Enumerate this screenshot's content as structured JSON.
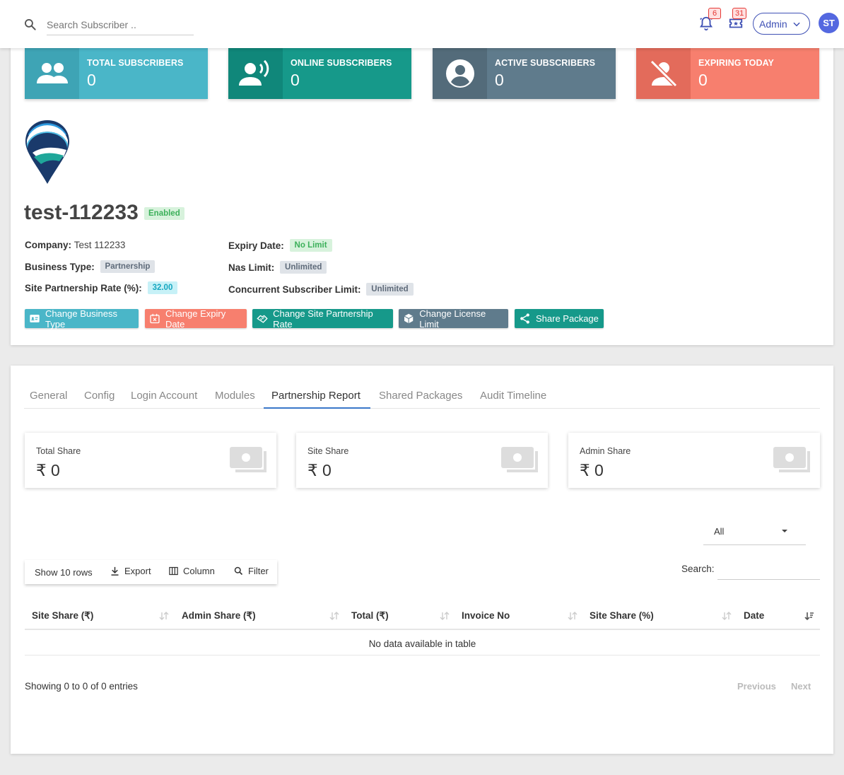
{
  "header": {
    "search_placeholder": "Search Subscriber ..",
    "notifications_count": "6",
    "tickets_count": "31",
    "admin_label": "Admin",
    "avatar_initials": "ST"
  },
  "stats": [
    {
      "label": "TOTAL SUBSCRIBERS",
      "value": "0",
      "icon": "group-icon",
      "color": "#4ab6c8"
    },
    {
      "label": "ONLINE SUBSCRIBERS",
      "value": "0",
      "icon": "speaking-user-icon",
      "color": "#16998a"
    },
    {
      "label": "ACTIVE SUBSCRIBERS",
      "value": "0",
      "icon": "account-circle-icon",
      "color": "#5f7b8c"
    },
    {
      "label": "EXPIRING TODAY",
      "value": "0",
      "icon": "person-off-icon",
      "color": "#f77f6e"
    }
  ],
  "profile": {
    "name": "test-112233",
    "status": "Enabled",
    "company_label": "Company:",
    "company_value": "Test 112233",
    "business_type_label": "Business Type:",
    "business_type_value": "Partnership",
    "rate_label": "Site Partnership Rate (%):",
    "rate_value": "32.00",
    "expiry_label": "Expiry Date:",
    "expiry_value": "No Limit",
    "nas_label": "Nas Limit:",
    "nas_value": "Unlimited",
    "concurrent_label": "Concurrent Subscriber Limit:",
    "concurrent_value": "Unlimited"
  },
  "actions": {
    "change_business_type": "Change Business Type",
    "change_expiry_date": "Change Expiry Date",
    "change_rate": "Change Site Partnership Rate",
    "change_license": "Change License Limit",
    "share_package": "Share Package"
  },
  "tabs": [
    "General",
    "Config",
    "Login Account",
    "Modules",
    "Partnership Report",
    "Shared Packages",
    "Audit Timeline"
  ],
  "active_tab": "Partnership Report",
  "shares": [
    {
      "label": "Total Share",
      "value": "₹ 0"
    },
    {
      "label": "Site Share",
      "value": "₹ 0"
    },
    {
      "label": "Admin Share",
      "value": "₹ 0"
    }
  ],
  "filter_select": "All",
  "toolbar": {
    "show_rows": "Show 10 rows",
    "export": "Export",
    "column": "Column",
    "filter": "Filter"
  },
  "table": {
    "search_label": "Search:",
    "columns": [
      "Site Share (₹)",
      "Admin Share (₹)",
      "Total (₹)",
      "Invoice No",
      "Site Share (%)",
      "Date"
    ],
    "empty_message": "No data available in table",
    "info": "Showing 0 to 0 of 0 entries",
    "previous": "Previous",
    "next": "Next"
  }
}
